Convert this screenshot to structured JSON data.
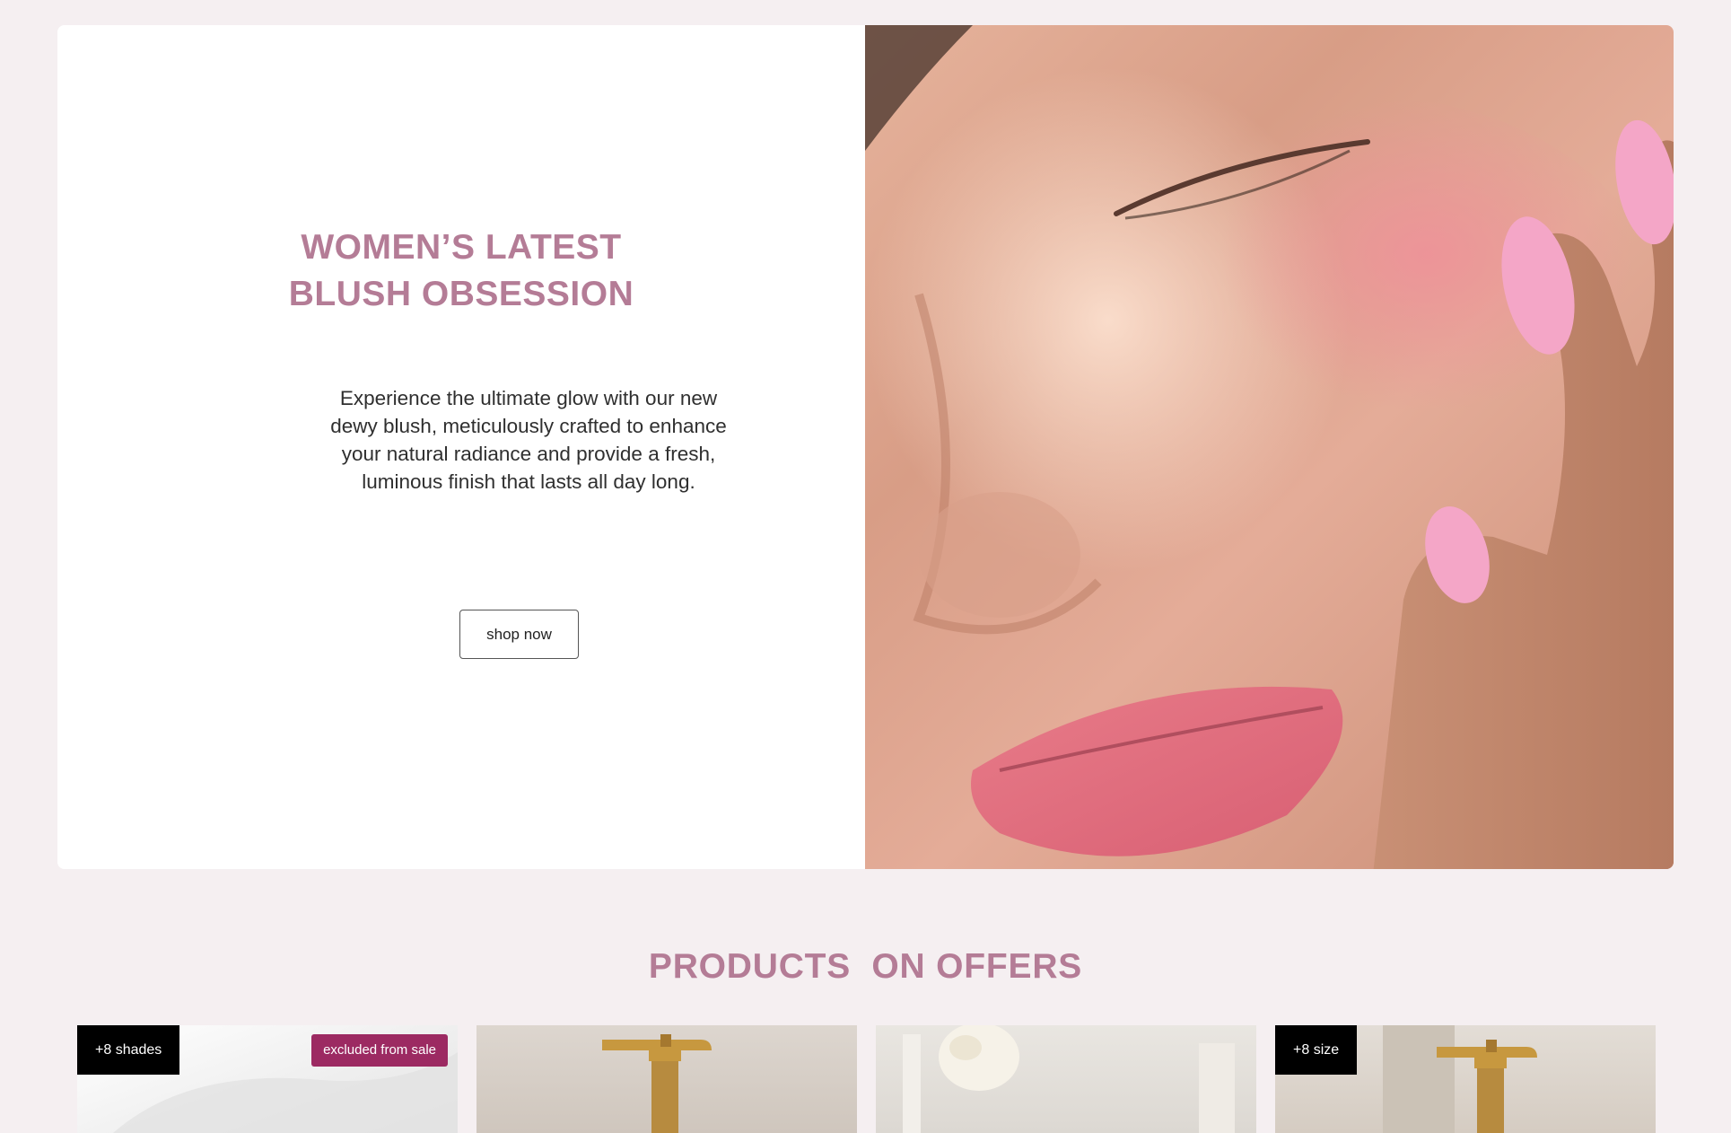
{
  "hero": {
    "title_line1": "WOMEN’S LATEST",
    "title_line2": "BLUSH OBSESSION",
    "description": "Experience the ultimate glow with our new dewy blush, meticulously crafted to enhance your natural radiance and provide a fresh, luminous finish that lasts all day long.",
    "cta_label": "shop now",
    "image_icon": "model-face-photo"
  },
  "offers": {
    "title": "PRODUCTS  ON OFFERS",
    "products": [
      {
        "badge_left": "+8 shades",
        "badge_right": "excluded from sale",
        "image_icon": "blush-product-photo"
      },
      {
        "image_icon": "gold-pump-bottle-photo"
      },
      {
        "image_icon": "white-flower-photo"
      },
      {
        "badge_left": "+8 size",
        "image_icon": "gold-pump-bottle-photo"
      }
    ]
  },
  "colors": {
    "accent": "#b47c96",
    "sale_badge": "#9c2a62",
    "background": "#f5eff1"
  }
}
